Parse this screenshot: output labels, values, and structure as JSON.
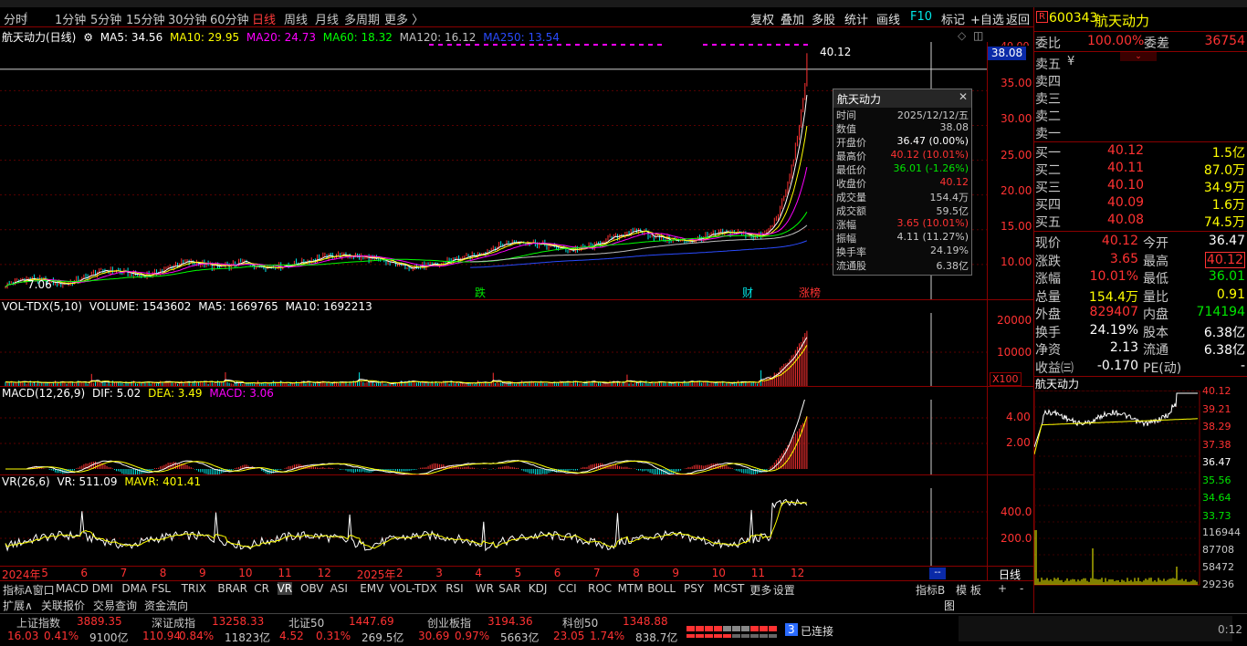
{
  "periods": [
    {
      "label": "分时",
      "on": false
    },
    {
      "label": "1分钟",
      "on": false
    },
    {
      "label": "5分钟",
      "on": false
    },
    {
      "label": "15分钟",
      "on": false
    },
    {
      "label": "30分钟",
      "on": false
    },
    {
      "label": "60分钟",
      "on": false
    },
    {
      "label": "日线",
      "on": true
    },
    {
      "label": "周线",
      "on": false
    },
    {
      "label": "月线",
      "on": false
    },
    {
      "label": "多周期",
      "on": false
    },
    {
      "label": "更多 〉",
      "on": false
    }
  ],
  "toolbar": [
    "复权",
    "叠加",
    "多股",
    "统计",
    "画线",
    "F10",
    "标记",
    "+自选",
    "返回"
  ],
  "main": {
    "name": "航天动力(日线)",
    "ma": [
      {
        "label": "MA5: 34.56",
        "color": "#ffffff"
      },
      {
        "label": "MA10: 29.95",
        "color": "#ffff00"
      },
      {
        "label": "MA20: 24.73",
        "color": "#ff00ff"
      },
      {
        "label": "MA60: 18.32",
        "color": "#00ff00"
      },
      {
        "label": "MA120: 16.12",
        "color": "#c0c0c0"
      },
      {
        "label": "MA250: 13.54",
        "color": "#2a4bff"
      }
    ],
    "axis": [
      "35.00",
      "30.00",
      "25.00",
      "20.00",
      "15.00",
      "10.00"
    ],
    "axis_partial": "40.00",
    "price_tag": "38.08",
    "high_label": "40.12",
    "low_label": "7.06",
    "markers": [
      "跌",
      "财",
      "涨榜"
    ]
  },
  "popup": {
    "title": "航天动力",
    "rows": [
      {
        "k": "时间",
        "v": "2025/12/12/五",
        "c": "#c8c8c8"
      },
      {
        "k": "数值",
        "v": "38.08",
        "c": "#c8c8c8"
      },
      {
        "k": "开盘价",
        "v": "36.47 (0.00%)",
        "c": "#ffffff"
      },
      {
        "k": "最高价",
        "v": "40.12 (10.01%)",
        "c": "#ff3232"
      },
      {
        "k": "最低价",
        "v": "36.01 (-1.26%)",
        "c": "#00e600"
      },
      {
        "k": "收盘价",
        "v": "40.12",
        "c": "#ff3232"
      },
      {
        "k": "成交量",
        "v": "154.4万",
        "c": "#c8c8c8"
      },
      {
        "k": "成交额",
        "v": "59.5亿",
        "c": "#c8c8c8"
      },
      {
        "k": "涨幅",
        "v": "3.65 (10.01%)",
        "c": "#ff3232"
      },
      {
        "k": "振幅",
        "v": "4.11 (11.27%)",
        "c": "#c8c8c8"
      },
      {
        "k": "换手率",
        "v": "24.19%",
        "c": "#c8c8c8"
      },
      {
        "k": "流通股",
        "v": "6.38亿",
        "c": "#c8c8c8"
      }
    ]
  },
  "vol": {
    "title": "VOL-TDX(5,10)",
    "items": [
      "VOLUME: 1543602",
      "MA5: 1669765",
      "MA10: 1692213"
    ],
    "axis": [
      "20000",
      "10000"
    ],
    "unit": "X100"
  },
  "macd": {
    "title": "MACD(12,26,9)",
    "dif": "DIF: 5.02",
    "dea": "DEA: 3.49",
    "macd": "MACD: 3.06",
    "axis": [
      "4.00",
      "2.00"
    ]
  },
  "vr": {
    "title": "VR(26,6)",
    "vr": "VR: 511.09",
    "mavr": "MAVR: 401.41",
    "axis": [
      "400.0",
      "200.0"
    ]
  },
  "months": [
    "2024年",
    "5",
    "6",
    "7",
    "8",
    "9",
    "10",
    "11",
    "12",
    "2025年",
    "2",
    "3",
    "4",
    "5",
    "6",
    "7",
    "8",
    "9",
    "10",
    "11",
    "12"
  ],
  "indicator_tabs": [
    "指标A",
    "窗口",
    "MACD",
    "DMI",
    "DMA",
    "FSL",
    "TRIX",
    "BRAR",
    "CR",
    "VR",
    "OBV",
    "ASI",
    "EMV",
    "VOL-TDX",
    "RSI",
    "WR",
    "SAR",
    "KDJ",
    "CCI",
    "ROC",
    "MTM",
    "BOLL",
    "PSY",
    "MCST",
    "更多",
    "设置"
  ],
  "right_tabs": [
    "指标B",
    "模 板",
    "+",
    "-"
  ],
  "sub_tabs": [
    "扩展∧",
    "关联报价",
    "交易查询",
    "资金流向"
  ],
  "day_label": "日线",
  "quote": {
    "code": "600343",
    "name": "航天动力",
    "webi_label": "委比",
    "webi": "100.00%",
    "wecha_label": "委差",
    "wecha": "36754",
    "sells": [
      "卖五",
      "卖四",
      "卖三",
      "卖二",
      "卖一"
    ],
    "buys": [
      {
        "l": "买一",
        "p": "40.12",
        "v": "1.5亿"
      },
      {
        "l": "买二",
        "p": "40.11",
        "v": "87.0万"
      },
      {
        "l": "买三",
        "p": "40.10",
        "v": "34.9万"
      },
      {
        "l": "买四",
        "p": "40.09",
        "v": "1.6万"
      },
      {
        "l": "买五",
        "p": "40.08",
        "v": "74.5万"
      }
    ],
    "stats": [
      {
        "l1": "现价",
        "v1": "40.12",
        "c1": "#ff3232",
        "l2": "今开",
        "v2": "36.47",
        "c2": "#ffffff"
      },
      {
        "l1": "涨跌",
        "v1": "3.65",
        "c1": "#ff3232",
        "l2": "最高",
        "v2": "40.12",
        "c2": "#ff3232"
      },
      {
        "l1": "涨幅",
        "v1": "10.01%",
        "c1": "#ff3232",
        "l2": "最低",
        "v2": "36.01",
        "c2": "#00e600"
      },
      {
        "l1": "总量",
        "v1": "154.4万",
        "c1": "#ffff00",
        "l2": "量比",
        "v2": "0.91",
        "c2": "#ffff00"
      },
      {
        "l1": "外盘",
        "v1": "829407",
        "c1": "#ff3232",
        "l2": "内盘",
        "v2": "714194",
        "c2": "#00e600"
      },
      {
        "l1": "换手",
        "v1": "24.19%",
        "c1": "#ffffff",
        "l2": "股本",
        "v2": "6.38亿",
        "c2": "#ffffff"
      },
      {
        "l1": "净资",
        "v1": "2.13",
        "c1": "#ffffff",
        "l2": "流通",
        "v2": "6.38亿",
        "c2": "#ffffff"
      },
      {
        "l1": "收益㈢",
        "v1": "-0.170",
        "c1": "#ffffff",
        "l2": "PE(动)",
        "v2": "-",
        "c2": "#ffffff"
      }
    ],
    "mini_title": "航天动力",
    "mini_price_axis": [
      "40.12",
      "39.21",
      "38.29",
      "37.38",
      "36.47",
      "35.56",
      "34.64",
      "33.73"
    ],
    "mini_vol_axis": [
      "116944",
      "87708",
      "58472",
      "29236"
    ],
    "mini_tag": "图"
  },
  "status": {
    "indices": [
      {
        "name": "上证指数",
        "val": "3889.35",
        "chg": "16.03",
        "pct": "0.41%",
        "amt": "9100亿"
      },
      {
        "name": "深证成指",
        "val": "13258.33",
        "chg": "110.94",
        "pct": "0.84%",
        "amt": "11823亿"
      },
      {
        "name": "北证50",
        "val": "1447.69",
        "chg": "4.52",
        "pct": "0.31%",
        "amt": "269.5亿"
      },
      {
        "name": "创业板指",
        "val": "3194.36",
        "chg": "30.69",
        "pct": "0.97%",
        "amt": "5663亿"
      },
      {
        "name": "科创50",
        "val": "1348.88",
        "chg": "23.05",
        "pct": "1.74%",
        "amt": "838.7亿"
      }
    ],
    "conn_num": "3",
    "conn": "已连接",
    "clock": "0:12"
  },
  "colors": {
    "up": "#ff3232",
    "down": "#00e600",
    "grid": "#8a0000"
  }
}
